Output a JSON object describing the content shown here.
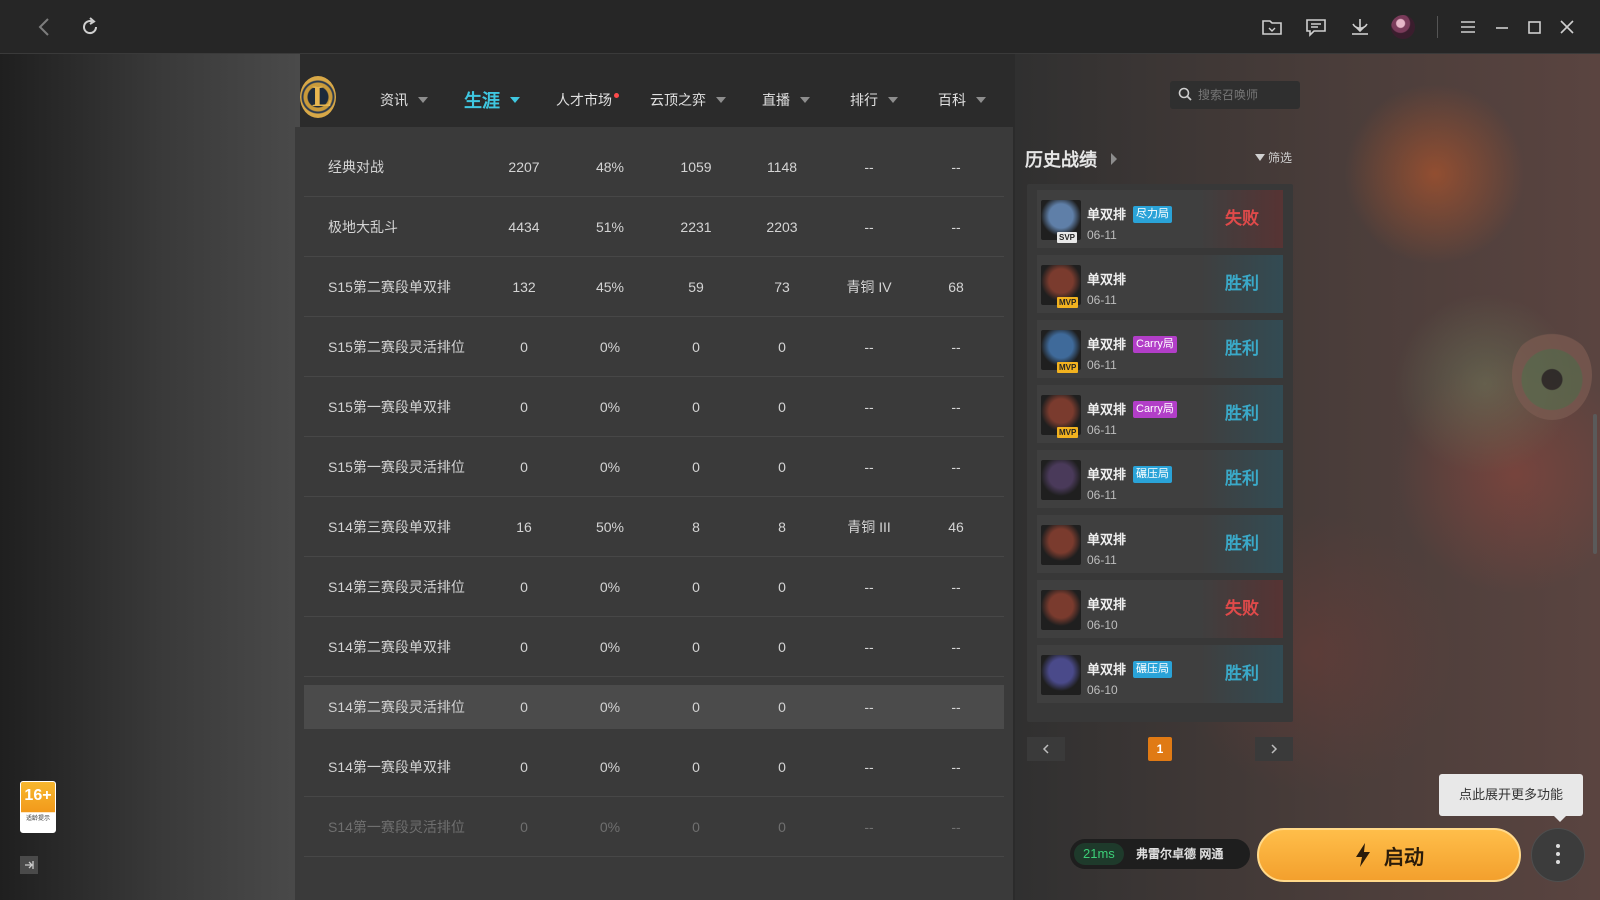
{
  "titlebar": {
    "back_icon": "chevron-left-icon",
    "refresh_icon": "refresh-icon"
  },
  "nav": {
    "items": [
      {
        "label": "资讯",
        "has_dropdown": true
      },
      {
        "label": "生涯",
        "has_dropdown": true,
        "active": true
      },
      {
        "label": "人才市场",
        "has_dropdown": false,
        "dot": true
      },
      {
        "label": "云顶之弈",
        "has_dropdown": true
      },
      {
        "label": "直播",
        "has_dropdown": true
      },
      {
        "label": "排行",
        "has_dropdown": true
      },
      {
        "label": "百科",
        "has_dropdown": true
      }
    ],
    "search_placeholder": "搜索召唤师"
  },
  "stats_table": {
    "rows": [
      {
        "mode": "经典对战",
        "total": "2207",
        "winrate": "48%",
        "wins": "1059",
        "losses": "1148",
        "rank": "--",
        "points": "--"
      },
      {
        "mode": "极地大乱斗",
        "total": "4434",
        "winrate": "51%",
        "wins": "2231",
        "losses": "2203",
        "rank": "--",
        "points": "--"
      },
      {
        "mode": "S15第二赛段单双排",
        "total": "132",
        "winrate": "45%",
        "wins": "59",
        "losses": "73",
        "rank": "青铜 IV",
        "points": "68"
      },
      {
        "mode": "S15第二赛段灵活排位",
        "total": "0",
        "winrate": "0%",
        "wins": "0",
        "losses": "0",
        "rank": "--",
        "points": "--"
      },
      {
        "mode": "S15第一赛段单双排",
        "total": "0",
        "winrate": "0%",
        "wins": "0",
        "losses": "0",
        "rank": "--",
        "points": "--"
      },
      {
        "mode": "S15第一赛段灵活排位",
        "total": "0",
        "winrate": "0%",
        "wins": "0",
        "losses": "0",
        "rank": "--",
        "points": "--"
      },
      {
        "mode": "S14第三赛段单双排",
        "total": "16",
        "winrate": "50%",
        "wins": "8",
        "losses": "8",
        "rank": "青铜 III",
        "points": "46"
      },
      {
        "mode": "S14第三赛段灵活排位",
        "total": "0",
        "winrate": "0%",
        "wins": "0",
        "losses": "0",
        "rank": "--",
        "points": "--"
      },
      {
        "mode": "S14第二赛段单双排",
        "total": "0",
        "winrate": "0%",
        "wins": "0",
        "losses": "0",
        "rank": "--",
        "points": "--"
      },
      {
        "mode": "S14第二赛段灵活排位",
        "total": "0",
        "winrate": "0%",
        "wins": "0",
        "losses": "0",
        "rank": "--",
        "points": "--"
      },
      {
        "mode": "S14第一赛段单双排",
        "total": "0",
        "winrate": "0%",
        "wins": "0",
        "losses": "0",
        "rank": "--",
        "points": "--"
      },
      {
        "mode": "S14第一赛段灵活排位",
        "total": "0",
        "winrate": "0%",
        "wins": "0",
        "losses": "0",
        "rank": "--",
        "points": "--"
      }
    ]
  },
  "history": {
    "title": "历史战绩",
    "filter_label": "筛选",
    "matches": [
      {
        "mode": "单双排",
        "tag": "尽力局",
        "tag_color": "#2aa3d8",
        "date": "06-11",
        "result": "失败",
        "win": false,
        "badge": "SVP",
        "champ_color": "#5f7fa8"
      },
      {
        "mode": "单双排",
        "tag": "",
        "tag_color": "",
        "date": "06-11",
        "result": "胜利",
        "win": true,
        "badge": "MVP",
        "champ_color": "#7a3b2e"
      },
      {
        "mode": "单双排",
        "tag": "Carry局",
        "tag_color": "#b23ec8",
        "date": "06-11",
        "result": "胜利",
        "win": true,
        "badge": "MVP",
        "champ_color": "#3f6a9a"
      },
      {
        "mode": "单双排",
        "tag": "Carry局",
        "tag_color": "#b23ec8",
        "date": "06-11",
        "result": "胜利",
        "win": true,
        "badge": "MVP",
        "champ_color": "#7a3b2e"
      },
      {
        "mode": "单双排",
        "tag": "碾压局",
        "tag_color": "#2aa3d8",
        "date": "06-11",
        "result": "胜利",
        "win": true,
        "badge": "",
        "champ_color": "#4a3a5a"
      },
      {
        "mode": "单双排",
        "tag": "",
        "tag_color": "",
        "date": "06-11",
        "result": "胜利",
        "win": true,
        "badge": "",
        "champ_color": "#7a3b2e"
      },
      {
        "mode": "单双排",
        "tag": "",
        "tag_color": "",
        "date": "06-10",
        "result": "失败",
        "win": false,
        "badge": "",
        "champ_color": "#7a3b2e"
      },
      {
        "mode": "单双排",
        "tag": "碾压局",
        "tag_color": "#2aa3d8",
        "date": "06-10",
        "result": "胜利",
        "win": true,
        "badge": "",
        "champ_color": "#4a4a8a"
      }
    ],
    "page": "1"
  },
  "bottom": {
    "tooltip": "点此展开更多功能",
    "ping": "21ms",
    "server": "弗雷尔卓德 网通",
    "launch_label": "启动"
  },
  "age_rating": {
    "number": "16+",
    "caption": "适龄提示"
  },
  "colors": {
    "accent": "#3fc7e0",
    "win": "#3aa9c8",
    "lose": "#e04a4a",
    "launch": "#f3a02d",
    "page_active": "#e07a14"
  }
}
